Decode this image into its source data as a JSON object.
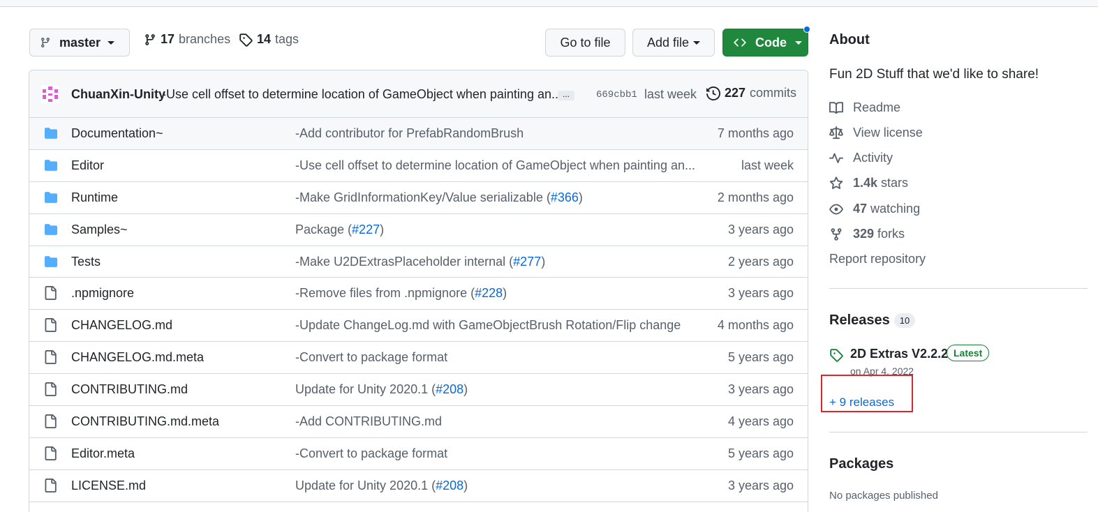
{
  "toolbar": {
    "branch": "master",
    "branches_count": "17",
    "branches_label": "branches",
    "tags_count": "14",
    "tags_label": "tags",
    "goto_file": "Go to file",
    "add_file": "Add file",
    "code": "Code"
  },
  "commit": {
    "author": "ChuanXin-Unity",
    "message": "-Use cell offset to determine location of GameObject when painting an...",
    "ellipsis": "...",
    "sha": "669cbb1",
    "when": "last week",
    "count": "227",
    "count_label": "commits"
  },
  "files": [
    {
      "type": "folder",
      "name": "Documentation~",
      "msg": "-Add contributor for PrefabRandomBrush",
      "pr_pre": "",
      "pr": "",
      "pr_post": "",
      "age": "7 months ago"
    },
    {
      "type": "folder",
      "name": "Editor",
      "msg": "-Use cell offset to determine location of GameObject when painting an...",
      "pr_pre": "",
      "pr": "",
      "pr_post": "",
      "age": "last week"
    },
    {
      "type": "folder",
      "name": "Runtime",
      "msg": "-Make GridInformationKey/Value serializable (",
      "pr": "#366",
      "pr_post": ")",
      "age": "2 months ago"
    },
    {
      "type": "folder",
      "name": "Samples~",
      "msg": "Package (",
      "pr": "#227",
      "pr_post": ")",
      "age": "3 years ago"
    },
    {
      "type": "folder",
      "name": "Tests",
      "msg": "-Make U2DExtrasPlaceholder internal (",
      "pr": "#277",
      "pr_post": ")",
      "age": "2 years ago"
    },
    {
      "type": "file",
      "name": ".npmignore",
      "msg": "-Remove files from .npmignore (",
      "pr": "#228",
      "pr_post": ")",
      "age": "3 years ago"
    },
    {
      "type": "file",
      "name": "CHANGELOG.md",
      "msg": "-Update ChangeLog.md with GameObjectBrush Rotation/Flip change",
      "pr": "",
      "pr_post": "",
      "age": "4 months ago"
    },
    {
      "type": "file",
      "name": "CHANGELOG.md.meta",
      "msg": "-Convert to package format",
      "pr": "",
      "pr_post": "",
      "age": "5 years ago"
    },
    {
      "type": "file",
      "name": "CONTRIBUTING.md",
      "msg": "Update for Unity 2020.1 (",
      "pr": "#208",
      "pr_post": ")",
      "age": "3 years ago"
    },
    {
      "type": "file",
      "name": "CONTRIBUTING.md.meta",
      "msg": "-Add CONTRIBUTING.md",
      "pr": "",
      "pr_post": "",
      "age": "4 years ago"
    },
    {
      "type": "file",
      "name": "Editor.meta",
      "msg": "-Convert to package format",
      "pr": "",
      "pr_post": "",
      "age": "5 years ago"
    },
    {
      "type": "file",
      "name": "LICENSE.md",
      "msg": "Update for Unity 2020.1 (",
      "pr": "#208",
      "pr_post": ")",
      "age": "3 years ago"
    }
  ],
  "about": {
    "title": "About",
    "description": "Fun 2D Stuff that we'd like to share!",
    "readme": "Readme",
    "license": "View license",
    "activity": "Activity",
    "stars_count": "1.4k",
    "stars_label": "stars",
    "watching_count": "47",
    "watching_label": "watching",
    "forks_count": "329",
    "forks_label": "forks",
    "report": "Report repository"
  },
  "releases": {
    "title": "Releases",
    "count": "10",
    "latest_name": "2D Extras V2.2.2",
    "latest_badge": "Latest",
    "latest_date": "on Apr 4, 2022",
    "more": "+ 9 releases"
  },
  "packages": {
    "title": "Packages",
    "empty": "No packages published"
  },
  "colors": {
    "accent_link": "#0969da",
    "code_button": "#1f883d",
    "folder": "#54aeff",
    "highlight_box": "#e0242b"
  }
}
